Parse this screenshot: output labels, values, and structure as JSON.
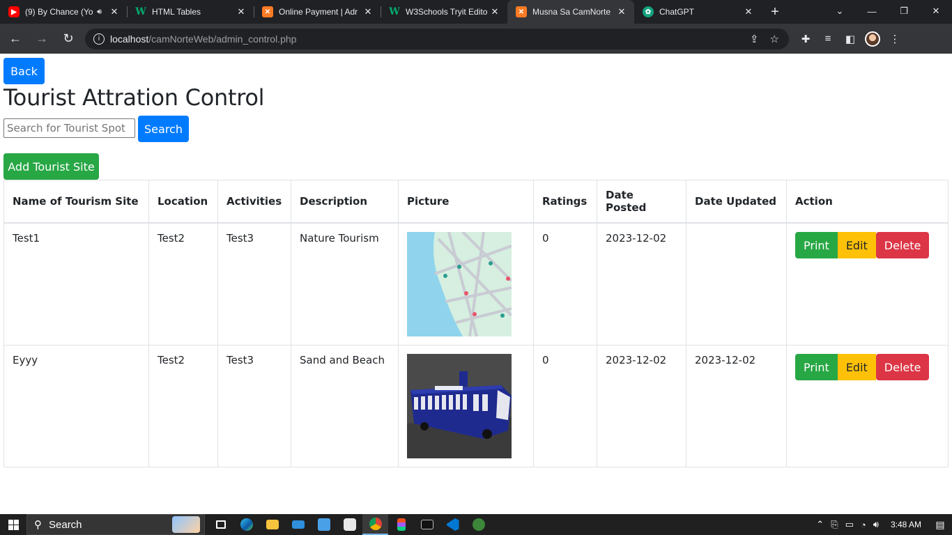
{
  "browser": {
    "tabs": [
      {
        "title": "(9) By Chance (Yo",
        "icon": "youtube-icon",
        "active": false
      },
      {
        "title": "HTML Tables",
        "icon": "w3schools-icon",
        "active": false
      },
      {
        "title": "Online Payment | Adr",
        "icon": "xampp-icon",
        "active": false
      },
      {
        "title": "W3Schools Tryit Edito",
        "icon": "w3schools-icon",
        "active": false
      },
      {
        "title": "Musna Sa CamNorte",
        "icon": "xampp-icon",
        "active": true
      },
      {
        "title": "ChatGPT",
        "icon": "chatgpt-icon",
        "active": false
      }
    ],
    "url_host": "localhost",
    "url_path": "/camNorteWeb/admin_control.php"
  },
  "page": {
    "back_label": "Back",
    "title": "Tourist Attration Control",
    "search_placeholder": "Search for Tourist Spot",
    "search_label": "Search",
    "add_label": "Add Tourist Site",
    "columns": [
      "Name of Tourism Site",
      "Location",
      "Activities",
      "Description",
      "Picture",
      "Ratings",
      "Date Posted",
      "Date Updated",
      "Action"
    ],
    "rows": [
      {
        "name": "Test1",
        "location": "Test2",
        "activities": "Test3",
        "description": "Nature Tourism",
        "picture": "map-thumbnail",
        "ratings": "0",
        "date_posted": "2023-12-02",
        "date_updated": ""
      },
      {
        "name": "Eyyy",
        "location": "Test2",
        "activities": "Test3",
        "description": "Sand and Beach",
        "picture": "bus-thumbnail",
        "ratings": "0",
        "date_posted": "2023-12-02",
        "date_updated": "2023-12-02"
      }
    ],
    "actions": {
      "print": "Print",
      "edit": "Edit",
      "delete": "Delete"
    },
    "colors": {
      "primary": "#007bff",
      "success": "#28a745",
      "warning": "#ffc107",
      "danger": "#dc3545"
    }
  },
  "taskbar": {
    "search_label": "Search",
    "time": "3:48 AM"
  }
}
